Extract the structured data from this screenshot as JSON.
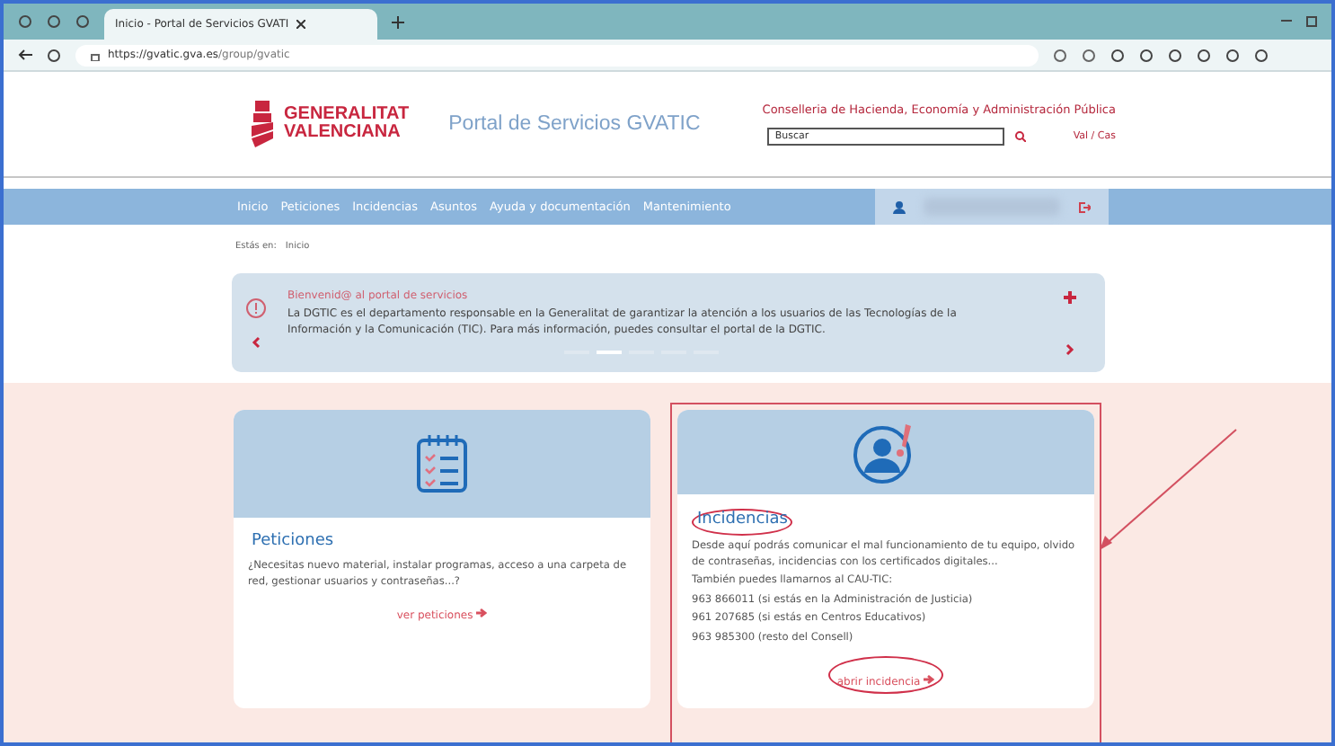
{
  "browser": {
    "tab_title": "Inicio - Portal de Servicios GVATI",
    "url_host": "https://gvatic.gva.es",
    "url_path": "/group/gvatic"
  },
  "header": {
    "logo_line1": "GENERALITAT",
    "logo_line2": "VALENCIANA",
    "portal_title": "Portal de Servicios GVATIC",
    "department": "Conselleria de Hacienda, Economía y Administración Pública",
    "search": {
      "placeholder": "Buscar"
    },
    "language": "Val / Cas"
  },
  "nav": {
    "items": [
      {
        "label": "Inicio"
      },
      {
        "label": "Peticiones"
      },
      {
        "label": "Incidencias"
      },
      {
        "label": "Asuntos"
      },
      {
        "label": "Ayuda y documentación"
      },
      {
        "label": "Mantenimiento"
      }
    ]
  },
  "breadcrumb": {
    "label": "Estás en:",
    "current": "Inicio"
  },
  "banner": {
    "title": "Bienvenid@ al portal de servicios",
    "text": "La DGTIC es el departamento responsable en la Generalitat de garantizar la atención a los usuarios de las Tecnologías de la Información y la Comunicación (TIC). Para más información, puedes consultar el portal de la DGTIC.",
    "dots": [
      {
        "selected": false
      },
      {
        "selected": true
      },
      {
        "selected": false
      },
      {
        "selected": false
      },
      {
        "selected": false
      }
    ]
  },
  "cards": [
    {
      "kind": "requests",
      "title": "Peticiones",
      "lines": [
        "¿Necesitas nuevo material, instalar programas, acceso a una carpeta de red, gestionar usuarios y contraseñas...?"
      ],
      "link": "ver peticiones",
      "highlighted": false
    },
    {
      "kind": "incidents",
      "title": "Incidencias",
      "lines": [
        "Desde aquí podrás comunicar el mal funcionamiento de tu equipo, olvido de contraseñas, incidencias con los certificados digitales...",
        "También puedes llamarnos al CAU-TIC:",
        "963 866011 (si estás en la Administración de Justicia)",
        "961 207685 (si estás en Centros Educativos)",
        "963 985300 (resto del Consell)"
      ],
      "link": "abrir incidencia",
      "highlighted": true
    }
  ]
}
